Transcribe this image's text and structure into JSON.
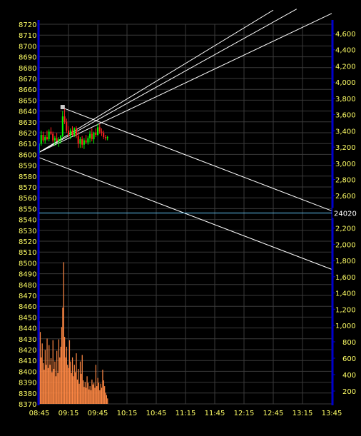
{
  "chart_data": {
    "type": "candlestick",
    "colors": {
      "background": "#000000",
      "grid": "#3a3a3a",
      "axis": "#0000cc",
      "tick_text": "#ffff66",
      "up": "#00ff00",
      "down": "#ff2222",
      "volume": "#ff8844",
      "lines": "#ffffff",
      "marker_line": "#66ccff"
    },
    "x_ticks": [
      "08:45",
      "09:15",
      "09:45",
      "10:15",
      "10:45",
      "11:15",
      "11:45",
      "12:15",
      "12:45",
      "13:15",
      "13:45"
    ],
    "y_left_ticks": [
      8720,
      8710,
      8700,
      8690,
      8680,
      8670,
      8660,
      8650,
      8640,
      8630,
      8620,
      8610,
      8600,
      8590,
      8580,
      8570,
      8560,
      8550,
      8540,
      8530,
      8520,
      8510,
      8500,
      8490,
      8480,
      8470,
      8460,
      8450,
      8440,
      8430,
      8420,
      8410,
      8400,
      8390,
      8380,
      8370
    ],
    "y_left_range": [
      8370,
      8720
    ],
    "y_right_upper_ticks": [
      "4,600",
      "4,400",
      "4,200",
      "4,000",
      "3,800",
      "3,600",
      "3,400",
      "3,200",
      "3,000",
      "2,800",
      "2,600",
      "2,400",
      "2,200",
      "2,000",
      "1,800",
      "1,600",
      "1,400",
      "1,200",
      "1,000"
    ],
    "y_right_lower_ticks": [
      "800",
      "600",
      "400",
      "200"
    ],
    "y_right_upper_values": [
      4600,
      4400,
      4200,
      4000,
      3800,
      3600,
      3400,
      3200,
      3000,
      2800,
      2600,
      2400,
      2200,
      2000,
      1800,
      1600,
      1400,
      1200,
      1000
    ],
    "y_right_lower_values": [
      800,
      600,
      400,
      200
    ],
    "right_scale_upper": [
      1000,
      4600
    ],
    "right_scale_lower": [
      200,
      800
    ],
    "marker_value": "24020",
    "marker_price": 8546,
    "time_range_minutes": [
      0,
      300
    ],
    "candles": [
      {
        "t": 0,
        "o": 8601,
        "h": 8612,
        "l": 8598,
        "c": 8610
      },
      {
        "t": 2,
        "o": 8610,
        "h": 8622,
        "l": 8608,
        "c": 8618
      },
      {
        "t": 4,
        "o": 8618,
        "h": 8621,
        "l": 8611,
        "c": 8613
      },
      {
        "t": 6,
        "o": 8613,
        "h": 8618,
        "l": 8610,
        "c": 8616
      },
      {
        "t": 8,
        "o": 8616,
        "h": 8622,
        "l": 8613,
        "c": 8614
      },
      {
        "t": 10,
        "o": 8614,
        "h": 8623,
        "l": 8612,
        "c": 8621
      },
      {
        "t": 12,
        "o": 8621,
        "h": 8625,
        "l": 8618,
        "c": 8619
      },
      {
        "t": 14,
        "o": 8619,
        "h": 8621,
        "l": 8611,
        "c": 8613
      },
      {
        "t": 16,
        "o": 8613,
        "h": 8617,
        "l": 8608,
        "c": 8615
      },
      {
        "t": 18,
        "o": 8615,
        "h": 8620,
        "l": 8612,
        "c": 8612
      },
      {
        "t": 20,
        "o": 8612,
        "h": 8616,
        "l": 8607,
        "c": 8614
      },
      {
        "t": 22,
        "o": 8614,
        "h": 8618,
        "l": 8610,
        "c": 8617
      },
      {
        "t": 24,
        "o": 8617,
        "h": 8640,
        "l": 8616,
        "c": 8635
      },
      {
        "t": 26,
        "o": 8635,
        "h": 8643,
        "l": 8628,
        "c": 8630
      },
      {
        "t": 28,
        "o": 8630,
        "h": 8633,
        "l": 8620,
        "c": 8622
      },
      {
        "t": 30,
        "o": 8622,
        "h": 8626,
        "l": 8616,
        "c": 8618
      },
      {
        "t": 32,
        "o": 8618,
        "h": 8624,
        "l": 8614,
        "c": 8622
      },
      {
        "t": 34,
        "o": 8622,
        "h": 8626,
        "l": 8617,
        "c": 8618
      },
      {
        "t": 36,
        "o": 8618,
        "h": 8625,
        "l": 8616,
        "c": 8624
      },
      {
        "t": 38,
        "o": 8624,
        "h": 8626,
        "l": 8615,
        "c": 8617
      },
      {
        "t": 40,
        "o": 8617,
        "h": 8621,
        "l": 8606,
        "c": 8610
      },
      {
        "t": 42,
        "o": 8610,
        "h": 8616,
        "l": 8606,
        "c": 8614
      },
      {
        "t": 44,
        "o": 8614,
        "h": 8617,
        "l": 8606,
        "c": 8609
      },
      {
        "t": 46,
        "o": 8609,
        "h": 8615,
        "l": 8605,
        "c": 8613
      },
      {
        "t": 48,
        "o": 8613,
        "h": 8618,
        "l": 8610,
        "c": 8611
      },
      {
        "t": 50,
        "o": 8611,
        "h": 8617,
        "l": 8609,
        "c": 8615
      },
      {
        "t": 52,
        "o": 8615,
        "h": 8622,
        "l": 8611,
        "c": 8619
      },
      {
        "t": 54,
        "o": 8619,
        "h": 8624,
        "l": 8612,
        "c": 8614
      },
      {
        "t": 56,
        "o": 8614,
        "h": 8621,
        "l": 8610,
        "c": 8620
      },
      {
        "t": 58,
        "o": 8620,
        "h": 8624,
        "l": 8616,
        "c": 8618
      },
      {
        "t": 60,
        "o": 8618,
        "h": 8628,
        "l": 8617,
        "c": 8625
      },
      {
        "t": 62,
        "o": 8625,
        "h": 8628,
        "l": 8619,
        "c": 8621
      },
      {
        "t": 64,
        "o": 8621,
        "h": 8624,
        "l": 8617,
        "c": 8620
      },
      {
        "t": 66,
        "o": 8620,
        "h": 8622,
        "l": 8614,
        "c": 8616
      },
      {
        "t": 68,
        "o": 8616,
        "h": 8618,
        "l": 8613,
        "c": 8615
      },
      {
        "t": 70,
        "o": 8615,
        "h": 8617,
        "l": 8613,
        "c": 8616
      }
    ],
    "volume": [
      {
        "t": 0,
        "v": 1050
      },
      {
        "t": 1,
        "v": 920
      },
      {
        "t": 2,
        "v": 610
      },
      {
        "t": 3,
        "v": 780
      },
      {
        "t": 4,
        "v": 540
      },
      {
        "t": 5,
        "v": 460
      },
      {
        "t": 6,
        "v": 700
      },
      {
        "t": 7,
        "v": 520
      },
      {
        "t": 8,
        "v": 840
      },
      {
        "t": 9,
        "v": 480
      },
      {
        "t": 10,
        "v": 760
      },
      {
        "t": 11,
        "v": 520
      },
      {
        "t": 12,
        "v": 600
      },
      {
        "t": 13,
        "v": 430
      },
      {
        "t": 14,
        "v": 820
      },
      {
        "t": 15,
        "v": 470
      },
      {
        "t": 16,
        "v": 560
      },
      {
        "t": 17,
        "v": 380
      },
      {
        "t": 18,
        "v": 690
      },
      {
        "t": 19,
        "v": 420
      },
      {
        "t": 20,
        "v": 830
      },
      {
        "t": 21,
        "v": 610
      },
      {
        "t": 22,
        "v": 740
      },
      {
        "t": 23,
        "v": 980
      },
      {
        "t": 24,
        "v": 1220
      },
      {
        "t": 25,
        "v": 1780
      },
      {
        "t": 26,
        "v": 860
      },
      {
        "t": 27,
        "v": 610
      },
      {
        "t": 28,
        "v": 740
      },
      {
        "t": 29,
        "v": 520
      },
      {
        "t": 30,
        "v": 480
      },
      {
        "t": 31,
        "v": 820
      },
      {
        "t": 32,
        "v": 560
      },
      {
        "t": 33,
        "v": 420
      },
      {
        "t": 34,
        "v": 610
      },
      {
        "t": 35,
        "v": 380
      },
      {
        "t": 36,
        "v": 520
      },
      {
        "t": 37,
        "v": 430
      },
      {
        "t": 38,
        "v": 660
      },
      {
        "t": 39,
        "v": 340
      },
      {
        "t": 40,
        "v": 470
      },
      {
        "t": 41,
        "v": 290
      },
      {
        "t": 42,
        "v": 560
      },
      {
        "t": 43,
        "v": 410
      },
      {
        "t": 44,
        "v": 640
      },
      {
        "t": 45,
        "v": 330
      },
      {
        "t": 46,
        "v": 250
      },
      {
        "t": 47,
        "v": 310
      },
      {
        "t": 48,
        "v": 240
      },
      {
        "t": 49,
        "v": 380
      },
      {
        "t": 50,
        "v": 300
      },
      {
        "t": 51,
        "v": 220
      },
      {
        "t": 52,
        "v": 260
      },
      {
        "t": 53,
        "v": 210
      },
      {
        "t": 54,
        "v": 340
      },
      {
        "t": 55,
        "v": 280
      },
      {
        "t": 56,
        "v": 300
      },
      {
        "t": 57,
        "v": 240
      },
      {
        "t": 58,
        "v": 520
      },
      {
        "t": 59,
        "v": 260
      },
      {
        "t": 60,
        "v": 360
      },
      {
        "t": 61,
        "v": 300
      },
      {
        "t": 62,
        "v": 210
      },
      {
        "t": 63,
        "v": 290
      },
      {
        "t": 64,
        "v": 240
      },
      {
        "t": 65,
        "v": 460
      },
      {
        "t": 66,
        "v": 330
      },
      {
        "t": 67,
        "v": 260
      },
      {
        "t": 68,
        "v": 180
      },
      {
        "t": 69,
        "v": 150
      },
      {
        "t": 70,
        "v": 110
      }
    ],
    "trend_lines": [
      {
        "t1": 0,
        "p1": 8602,
        "t2": 240,
        "p2": 8733
      },
      {
        "t1": 0,
        "p1": 8602,
        "t2": 264,
        "p2": 8734
      },
      {
        "t1": 0,
        "p1": 8602,
        "t2": 300,
        "p2": 8730
      },
      {
        "t1": 24,
        "p1": 8643,
        "t2": 300,
        "p2": 8548
      },
      {
        "t1": 0,
        "p1": 8597,
        "t2": 300,
        "p2": 8494
      }
    ],
    "pivot_marker": {
      "t": 24,
      "p": 8643
    }
  }
}
